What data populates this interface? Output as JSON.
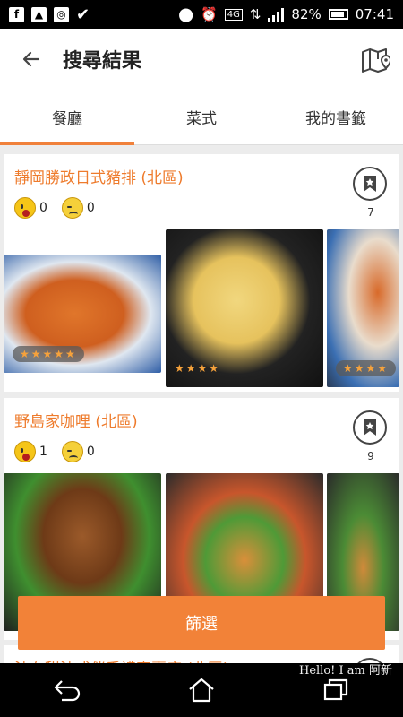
{
  "status_bar": {
    "left_icons": [
      "facebook-icon",
      "gallery-icon",
      "instagram-icon",
      "check-icon"
    ],
    "network": "4G",
    "battery": "82%",
    "time": "07:41"
  },
  "appbar": {
    "title": "搜尋結果",
    "back_icon": "arrow-left-icon",
    "map_icon": "map-pin-icon"
  },
  "tabs": [
    {
      "label": "餐廳",
      "active": true
    },
    {
      "label": "菜式",
      "active": false
    },
    {
      "label": "我的書籤",
      "active": false
    }
  ],
  "restaurants": [
    {
      "name": "靜岡勝政日式豬排 (北區)",
      "like_count": "0",
      "dislike_count": "0",
      "bookmark_count": "7",
      "photos": [
        {
          "subject": "fried-pork-cutlet",
          "stars": "★★★★★"
        },
        {
          "subject": "tamagoyaki",
          "stars": "★★★★"
        },
        {
          "subject": "katsu-rice-bowl",
          "stars": "★★★★"
        }
      ]
    },
    {
      "name": "野島家咖哩 (北區)",
      "like_count": "1",
      "dislike_count": "0",
      "bookmark_count": "9",
      "photos": [
        {
          "subject": "curry-pork-cutlet",
          "stars": ""
        },
        {
          "subject": "fried-platter",
          "stars": ""
        },
        {
          "subject": "fried-chicken",
          "stars": ""
        }
      ]
    },
    {
      "name": "法布甜法式伴手禮專賣店 (北區)"
    }
  ],
  "filter_button": {
    "label": "篩選"
  },
  "watermark": "Hello! I am 阿新",
  "colors": {
    "accent": "#f0813b",
    "filter": "#f28238",
    "title_text": "#ee7b2c"
  }
}
